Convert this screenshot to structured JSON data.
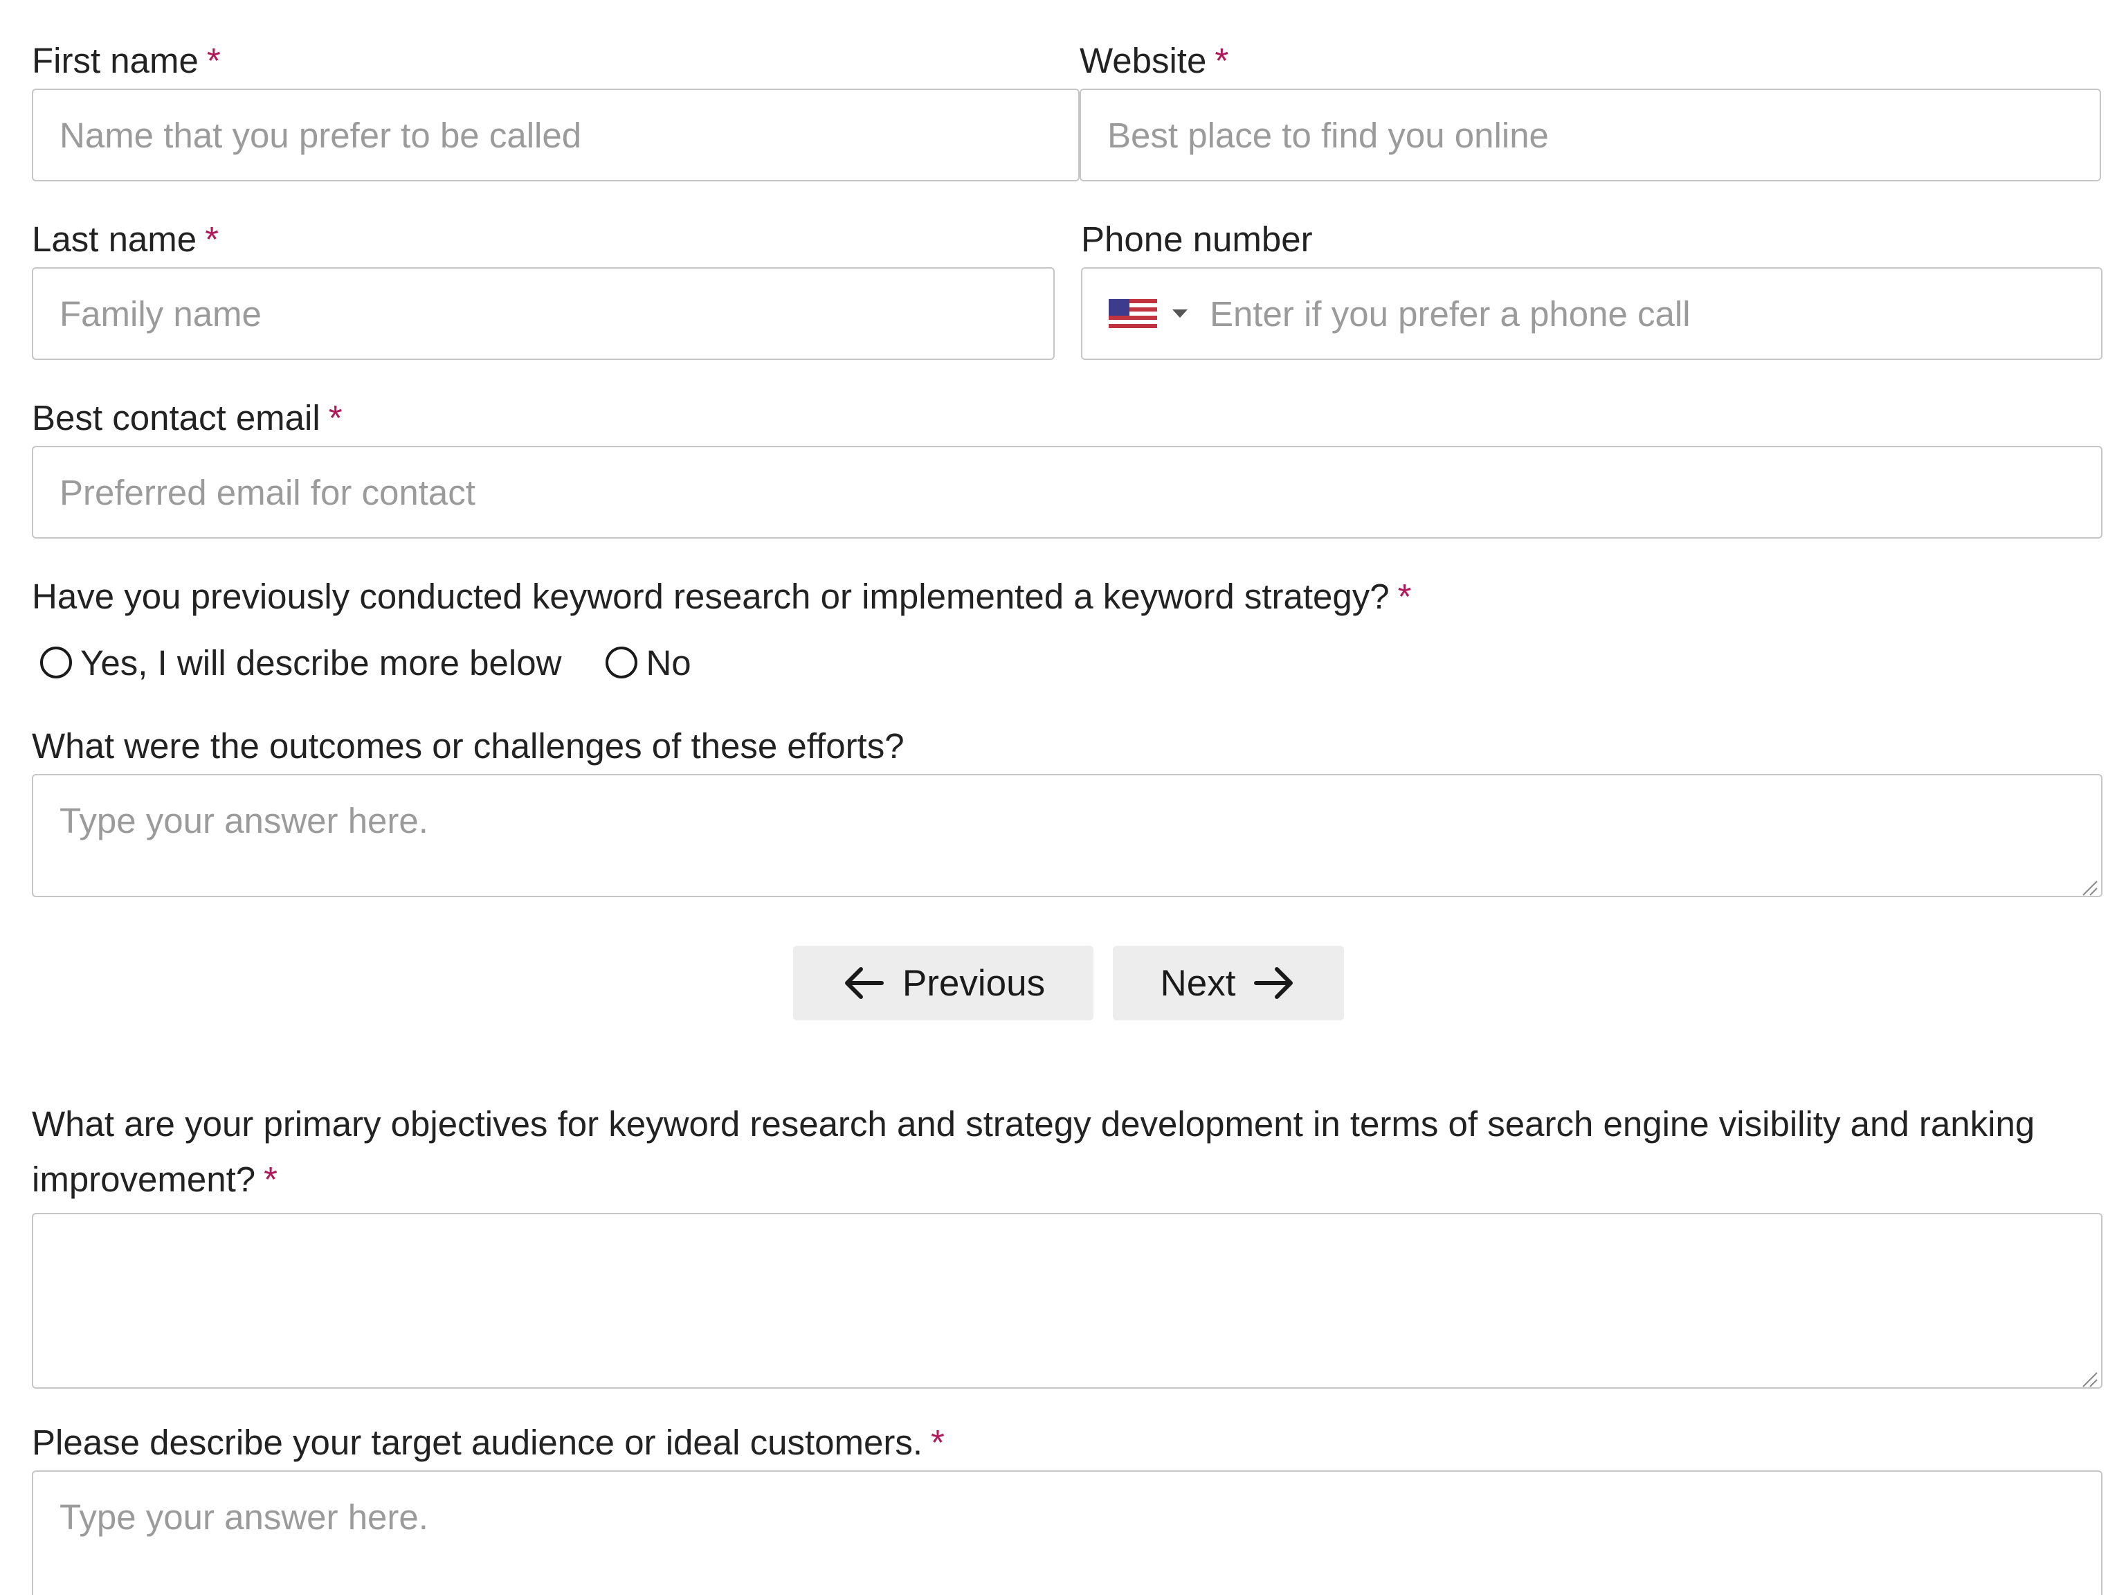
{
  "form": {
    "first_name": {
      "label": "First name",
      "required": "*",
      "placeholder": "Name that you prefer to be called"
    },
    "website": {
      "label": "Website",
      "required": "*",
      "placeholder": "Best place to find you online"
    },
    "last_name": {
      "label": "Last name",
      "required": "*",
      "placeholder": "Family name"
    },
    "phone": {
      "label": "Phone number",
      "placeholder": "Enter if you prefer a phone call",
      "country_flag": "us-flag-icon"
    },
    "email": {
      "label": "Best contact email",
      "required": "*",
      "placeholder": "Preferred email for contact"
    },
    "keyword_question": {
      "label": "Have you previously conducted keyword research or implemented a keyword strategy?",
      "required": "*",
      "options": [
        "Yes, I will describe more below",
        "No"
      ]
    },
    "outcomes": {
      "label": "What were the outcomes or challenges of these efforts?",
      "placeholder": "Type your answer here."
    },
    "objectives": {
      "label": "What are your primary objectives for keyword research and strategy development in terms of search engine visibility and ranking improvement?",
      "required": "*",
      "placeholder": ""
    },
    "audience": {
      "label": "Please describe your target audience or ideal customers.",
      "required": "*",
      "placeholder": "Type your answer here."
    }
  },
  "nav": {
    "previous_label": "Previous",
    "next_label": "Next"
  },
  "colors": {
    "required": "#b0185a",
    "button_bg": "#ededed",
    "border": "#c6c6c6",
    "placeholder": "#9b9b9b"
  }
}
